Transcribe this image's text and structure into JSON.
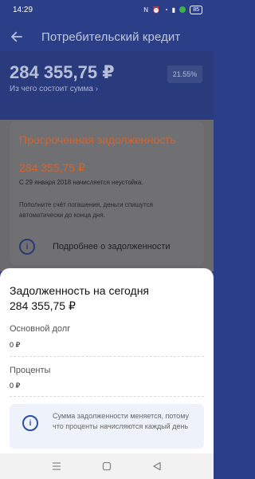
{
  "status": {
    "time": "14:29",
    "battery": "85"
  },
  "header": {
    "title": "Потребительский кредит"
  },
  "summary": {
    "amount": "284 355,75 ₽",
    "link": "Из чего состоит сумма",
    "rate": "21.55%"
  },
  "overdue": {
    "title": "Просроченная задолженность",
    "amount": "284 355,75 ₽",
    "note": "С 29 января 2018 начисляется неустойка.",
    "desc": "Пополните счёт погашения, деньги спишутся автоматически до конца дня.",
    "more": "Подробнее о задолженности"
  },
  "sheet": {
    "title": "Задолженность на сегодня",
    "amount": "284 355,75 ₽",
    "rows": [
      {
        "label": "Основной долг",
        "value": "0 ₽"
      },
      {
        "label": "Проценты",
        "value": "0 ₽"
      }
    ],
    "info": "Сумма задолженности меняется, потому что проценты начисляются каждый день"
  },
  "colors": {
    "accent": "#2a4ea0",
    "overdue": "#d26430",
    "header_bg": "#293b7d"
  }
}
